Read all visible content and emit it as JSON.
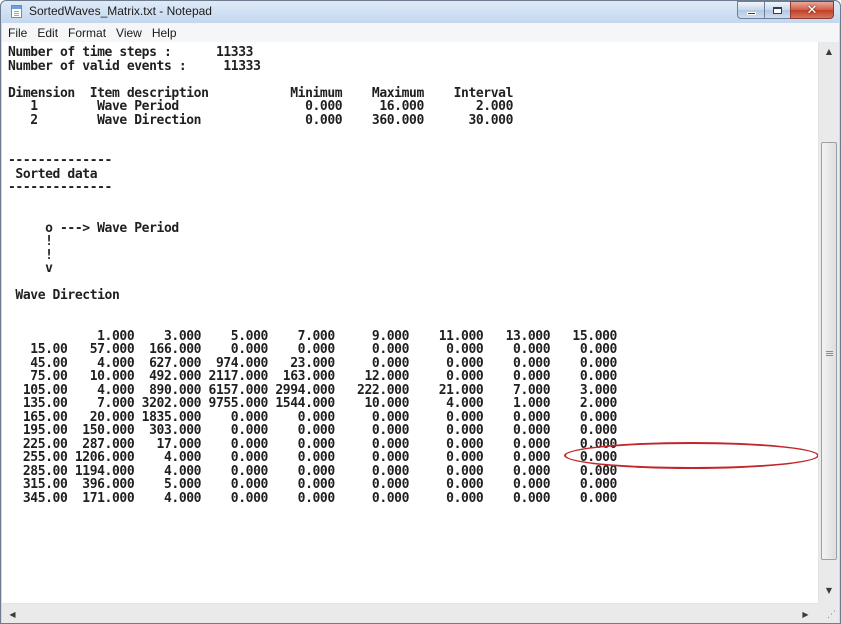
{
  "window": {
    "title": "SortedWaves_Matrix.txt - Notepad",
    "buttons": {
      "minimize_icon": "minimize-icon",
      "maximize_icon": "maximize-icon",
      "close_icon": "close-icon"
    }
  },
  "menu": [
    "File",
    "Edit",
    "Format",
    "View",
    "Help"
  ],
  "document": {
    "text": "Number of time steps :      11333\nNumber of valid events :     11333\n\nDimension  Item description           Minimum    Maximum    Interval\n   1        Wave Period                 0.000     16.000       2.000\n   2        Wave Direction              0.000    360.000      30.000\n\n\n--------------\n Sorted data\n--------------\n\n\n     o ---> Wave Period\n     !\n     !\n     v\n\n Wave Direction\n\n\n            1.000    3.000    5.000    7.000     9.000    11.000   13.000   15.000\n   15.00   57.000  166.000    0.000    0.000     0.000     0.000    0.000    0.000\n   45.00    4.000  627.000  974.000   23.000     0.000     0.000    0.000    0.000\n   75.00   10.000  492.000 2117.000  163.000    12.000     0.000    0.000    0.000\n  105.00    4.000  890.000 6157.000 2994.000   222.000    21.000    7.000    3.000\n  135.00    7.000 3202.000 9755.000 1544.000    10.000     4.000    1.000    2.000\n  165.00   20.000 1835.000    0.000    0.000     0.000     0.000    0.000    0.000\n  195.00  150.000  303.000    0.000    0.000     0.000     0.000    0.000    0.000\n  225.00  287.000   17.000    0.000    0.000     0.000     0.000    0.000    0.000\n  255.00 1206.000    4.000    0.000    0.000     0.000     0.000    0.000    0.000\n  285.00 1194.000    4.000    0.000    0.000     0.000     0.000    0.000    0.000\n  315.00  396.000    5.000    0.000    0.000     0.000     0.000    0.000    0.000\n  345.00  171.000    4.000    0.000    0.000     0.000     0.000    0.000    0.000"
  },
  "annotation": {
    "color": "#c0262b"
  },
  "scrollbars": {
    "up_icon": "scroll-up-icon",
    "down_icon": "scroll-down-icon",
    "left_icon": "scroll-left-icon",
    "right_icon": "scroll-right-icon"
  }
}
